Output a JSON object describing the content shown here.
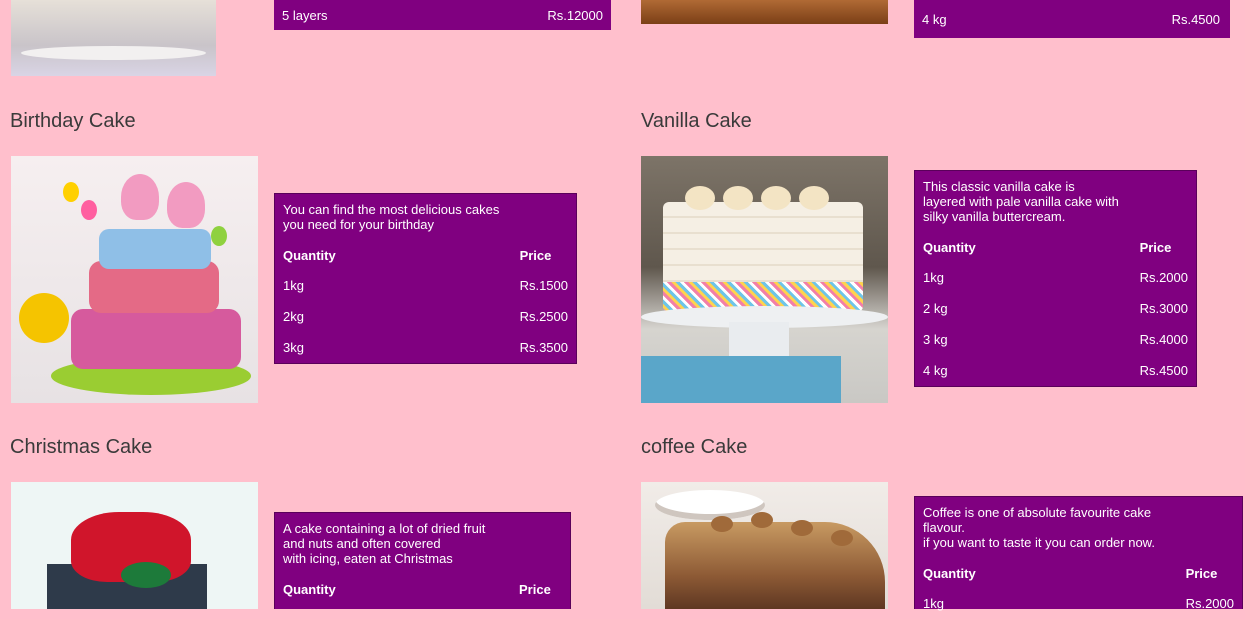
{
  "top": {
    "left_bar": {
      "quantity": "5 layers",
      "price": "Rs.12000"
    },
    "right_bar": {
      "quantity": "4 kg",
      "price": "Rs.4500"
    }
  },
  "cakes": [
    {
      "name": "Birthday Cake",
      "description": [
        "You can find the most delicious cakes",
        "you need for your birthday"
      ],
      "header": {
        "quantity": "Quantity",
        "price": "Price"
      },
      "rows": [
        {
          "quantity": "1kg",
          "price": "Rs.1500"
        },
        {
          "quantity": "2kg",
          "price": "Rs.2500"
        },
        {
          "quantity": "3kg",
          "price": "Rs.3500"
        }
      ]
    },
    {
      "name": "Vanilla Cake",
      "description": [
        "This classic vanilla cake is",
        "layered with pale vanilla cake with",
        "silky vanilla buttercream."
      ],
      "header": {
        "quantity": "Quantity",
        "price": "Price"
      },
      "rows": [
        {
          "quantity": "1kg",
          "price": "Rs.2000"
        },
        {
          "quantity": "2 kg",
          "price": "Rs.3000"
        },
        {
          "quantity": "3 kg",
          "price": "Rs.4000"
        },
        {
          "quantity": "4 kg",
          "price": "Rs.4500"
        }
      ]
    },
    {
      "name": "Christmas Cake",
      "description": [
        "A cake containing a lot of dried fruit",
        "and nuts and often covered",
        "with icing, eaten at Christmas"
      ],
      "header": {
        "quantity": "Quantity",
        "price": "Price"
      },
      "rows": []
    },
    {
      "name": "coffee Cake",
      "description": [
        "Coffee is one of absolute favourite cake",
        "flavour.",
        "if you want to taste it you can order now."
      ],
      "header": {
        "quantity": "Quantity",
        "price": "Price"
      },
      "rows": [
        {
          "quantity": "1kg",
          "price": "Rs.2000"
        }
      ]
    }
  ],
  "colors": {
    "background": "#ffbfcc",
    "panel": "#800080"
  }
}
